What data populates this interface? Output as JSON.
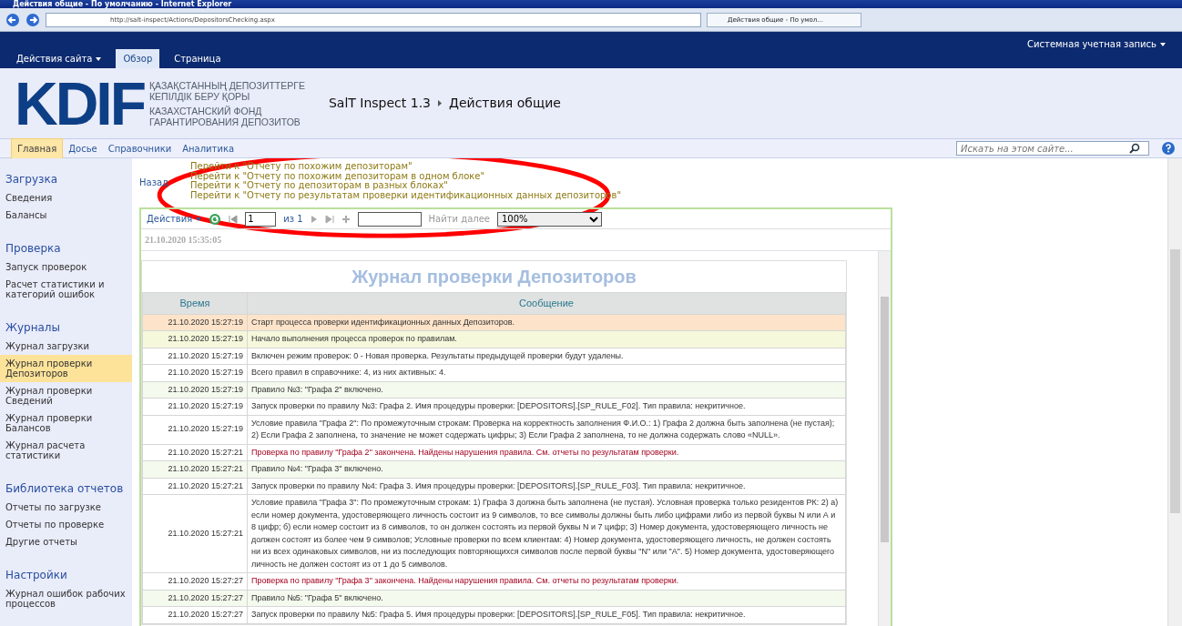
{
  "browser": {
    "title": "Действия общие - По умолчанию - Internet Explorer",
    "address": "http://salt-inspect/Actions/DepositorsChecking.aspx",
    "tab_title": "Действия общие - По умол..."
  },
  "ribbon": {
    "site_actions": "Действия сайта",
    "tabs": [
      {
        "label": "Обзор",
        "selected": true
      },
      {
        "label": "Страница",
        "selected": false
      }
    ],
    "account": "Системная учетная запись"
  },
  "header": {
    "logo": "KDIF",
    "org_kz": [
      "ҚАЗАҚСТАННЫҢ ДЕПОЗИТТЕРГЕ",
      "КЕПІЛДІК БЕРУ ҚОРЫ"
    ],
    "org_ru": [
      "КАЗАХСТАНСКИЙ ФОНД",
      "ГАРАНТИРОВАНИЯ ДЕПОЗИТОВ"
    ],
    "breadcrumb": [
      "SalT Inspect 1.3",
      "Действия общие"
    ]
  },
  "topnav": {
    "items": [
      {
        "label": "Главная",
        "selected": true
      },
      {
        "label": "Досье",
        "selected": false
      },
      {
        "label": "Справочники",
        "selected": false
      },
      {
        "label": "Аналитика",
        "selected": false
      }
    ],
    "search": {
      "placeholder": "Искать на этом сайте..."
    }
  },
  "sidebar": [
    {
      "heading": "Загрузка",
      "items": [
        {
          "label": "Сведения",
          "selected": false
        },
        {
          "label": "Балансы",
          "selected": false
        }
      ]
    },
    {
      "heading": "Проверка",
      "items": [
        {
          "label": "Запуск проверок",
          "selected": false
        },
        {
          "label": "Расчет статистики и категорий ошибок",
          "selected": false
        }
      ]
    },
    {
      "heading": "Журналы",
      "items": [
        {
          "label": "Журнал загрузки",
          "selected": false
        },
        {
          "label": "Журнал проверки Депозиторов",
          "selected": true
        },
        {
          "label": "Журнал проверки Сведений",
          "selected": false
        },
        {
          "label": "Журнал проверки Балансов",
          "selected": false
        },
        {
          "label": "Журнал расчета статистики",
          "selected": false
        }
      ]
    },
    {
      "heading": "Библиотека отчетов",
      "items": [
        {
          "label": "Отчеты по загрузке",
          "selected": false
        },
        {
          "label": "Отчеты по проверке",
          "selected": false
        },
        {
          "label": "Другие отчеты",
          "selected": false
        }
      ]
    },
    {
      "heading": "Настройки",
      "items": [
        {
          "label": "Журнал ошибок рабочих процессов",
          "selected": false
        }
      ]
    }
  ],
  "back_link": "Назад",
  "report_links": [
    "Перейти к \"Отчету по похожим депозиторам\"",
    "Перейти к \"Отчету по похожим депозиторам в одном блоке\"",
    "Перейти к \"Отчету по депозиторам в разных блоках\"",
    "Перейти к \"Отчету по результатам проверки идентификационных данных депозиторов\""
  ],
  "toolbar": {
    "actions": "Действия",
    "page": "1",
    "of": "из 1",
    "find_next": "Найти далее",
    "zoom": "100%"
  },
  "report": {
    "timestamp": "21.10.2020 15:35:05",
    "title": "Журнал проверки Депозиторов",
    "columns": [
      "Время",
      "Сообщение"
    ],
    "rows": [
      {
        "kind": "start",
        "time": "21.10.2020 15:27:19",
        "message": "Старт процесса проверки идентификационных данных Депозиторов."
      },
      {
        "kind": "begin",
        "time": "21.10.2020 15:27:19",
        "message": "Начало выполнения процесса проверок по правилам."
      },
      {
        "kind": "info",
        "time": "21.10.2020 15:27:19",
        "message": "Включен режим проверок: 0 - Новая проверка. Результаты предыдущей проверки будут удалены."
      },
      {
        "kind": "info",
        "time": "21.10.2020 15:27:19",
        "message": "Всего правил в справочнике: 4, из них активных: 4."
      },
      {
        "kind": "enabled",
        "time": "21.10.2020 15:27:19",
        "message": "Правило №3: \"Графа 2\" включено."
      },
      {
        "kind": "info",
        "time": "21.10.2020 15:27:19",
        "message": "Запуск проверки по правилу №3: Графа 2. Имя процедуры проверки: [DEPOSITORS].[SP_RULE_F02]. Тип правила: некритичное."
      },
      {
        "kind": "info",
        "time": "21.10.2020 15:27:19",
        "message": "Условие правила \"Графа 2\": По промежуточным строкам: Проверка на корректность заполнения Ф.И.О.: 1) Графа 2 должна быть заполнена (не пустая); 2) Если Графа 2 заполнена, то значение не может содержать цифры; 3) Если Графа 2 заполнена, то не должна содержать слово «NULL»."
      },
      {
        "kind": "violation",
        "time": "21.10.2020 15:27:21",
        "message": "Проверка по правилу \"Графа 2\" закончена. Найдены нарушения правила. См. отчеты по результатам проверки."
      },
      {
        "kind": "enabled",
        "time": "21.10.2020 15:27:21",
        "message": "Правило №4: \"Графа 3\" включено."
      },
      {
        "kind": "info",
        "time": "21.10.2020 15:27:21",
        "message": "Запуск проверки по правилу №4: Графа 3. Имя процедуры проверки: [DEPOSITORS].[SP_RULE_F03]. Тип правила: некритичное."
      },
      {
        "kind": "info",
        "time": "21.10.2020 15:27:21",
        "message": "Условие правила \"Графа 3\": По промежуточным строкам: 1) Графа 3 должна быть заполнена (не пустая). Условная проверка только резидентов РК: 2) а) если номер документа, удостоверяющего личность состоит из 9 символов, то все символы должны быть либо цифрами либо из первой буквы N или А и 8 цифр; б) если номер состоит из 8 символов, то он должен состоять из первой буквы N и 7 цифр; 3) Номер документа, удостоверяющего личность не должен состоят из более чем 9 символов; Условные проверки по всем клиентам: 4) Номер документа, удостоверяющего личность, не должен состоять ни из всех одинаковых символов, ни из последующих повторяющихся символов после первой буквы \"N\" или \"А\". 5) Номер документа, удостоверяющего личность не должен состоят из от 1 до 5 символов."
      },
      {
        "kind": "violation",
        "time": "21.10.2020 15:27:27",
        "message": "Проверка по правилу \"Графа 3\" закончена. Найдены нарушения правила. См. отчеты по результатам проверки."
      },
      {
        "kind": "enabled",
        "time": "21.10.2020 15:27:27",
        "message": "Правило №5: \"Графа 5\" включено."
      },
      {
        "kind": "info",
        "time": "21.10.2020 15:27:27",
        "message": "Запуск проверки по правилу №5: Графа 5. Имя процедуры проверки: [DEPOSITORS].[SP_RULE_F05]. Тип правила: некритичное."
      }
    ]
  }
}
